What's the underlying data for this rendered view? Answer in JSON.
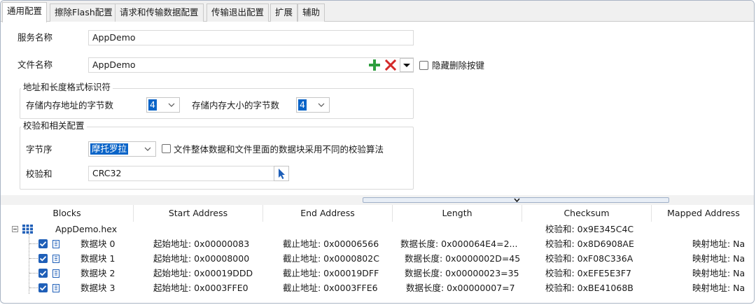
{
  "tabs": [
    {
      "label": "通用配置",
      "active": true
    },
    {
      "label": "擦除Flash配置",
      "active": false
    },
    {
      "label": "请求和传输数据配置",
      "active": false
    },
    {
      "label": "传输退出配置",
      "active": false
    },
    {
      "label": "扩展",
      "active": false
    },
    {
      "label": "辅助",
      "active": false
    }
  ],
  "service": {
    "label": "服务名称",
    "value": "AppDemo"
  },
  "file": {
    "label": "文件名称",
    "value": "AppDemo",
    "hide_delete_label": "隐藏删除按键",
    "hide_delete_checked": false
  },
  "address_group": {
    "title": "地址和长度格式标识符",
    "addr_bytes_label": "存储内存地址的字节数",
    "addr_bytes_value": "4",
    "size_bytes_label": "存储内存大小的字节数",
    "size_bytes_value": "4"
  },
  "checksum_group": {
    "title": "校验和相关配置",
    "byte_order_label": "字节序",
    "byte_order_value": "摩托罗拉",
    "diff_algo_label": "文件整体数据和文件里面的数据块采用不同的校验算法",
    "diff_algo_checked": false,
    "checksum_label": "校验和",
    "checksum_value": "CRC32"
  },
  "table": {
    "columns": [
      "Blocks",
      "Start Address",
      "End Address",
      "Length",
      "Checksum",
      "Mapped Address"
    ],
    "root": {
      "name": "AppDemo.hex",
      "checksum": "校验和: 0x9E345C4C"
    },
    "blocks": [
      {
        "name": "数据块 0",
        "start": "起始地址: 0x00000083",
        "end": "截止地址: 0x00006566",
        "length": "数据长度: 0x000064E4=2...",
        "checksum": "校验和: 0x8D6908AE",
        "mapped": "映射地址: Na"
      },
      {
        "name": "数据块 1",
        "start": "起始地址: 0x00008000",
        "end": "截止地址: 0x0000802C",
        "length": "数据长度: 0x0000002D=45",
        "checksum": "校验和: 0xF08C336A",
        "mapped": "映射地址: Na"
      },
      {
        "name": "数据块 2",
        "start": "起始地址: 0x00019DDD",
        "end": "截止地址: 0x00019DFF",
        "length": "数据长度: 0x00000023=35",
        "checksum": "校验和: 0xEFE5E3F7",
        "mapped": "映射地址: Na"
      },
      {
        "name": "数据块 3",
        "start": "起始地址: 0x0003FFE0",
        "end": "截止地址: 0x0003FFE6",
        "length": "数据长度: 0x00000007=7",
        "checksum": "校验和: 0xBE41068B",
        "mapped": "映射地址: Na"
      }
    ]
  },
  "colors": {
    "accent": "#0a64c8",
    "checkbox": "#1f5fb8",
    "add": "#2e9e3e",
    "delete": "#d42a2a"
  }
}
